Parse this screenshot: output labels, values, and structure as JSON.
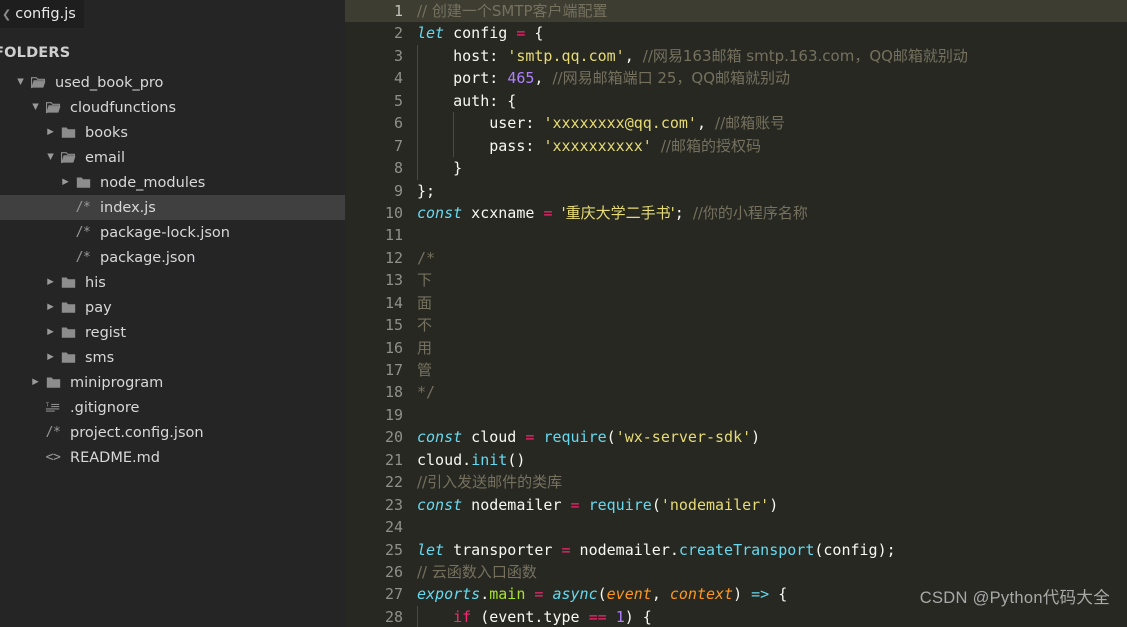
{
  "window": {
    "sidebar_bg": "#252526",
    "editor_bg": "#272822",
    "accent_selection": "#404040"
  },
  "tabs": {
    "open_file": "config.js",
    "overflow_icon": "chevron-left-icon"
  },
  "sidebar": {
    "section_label": "FOLDERS",
    "items": [
      {
        "label": "used_book_pro",
        "icon": "folder-open-icon",
        "twisty": "▼",
        "depth": 0,
        "selected": false
      },
      {
        "label": "cloudfunctions",
        "icon": "folder-open-icon",
        "twisty": "▼",
        "depth": 1,
        "selected": false
      },
      {
        "label": "books",
        "icon": "folder-closed-icon",
        "twisty": "▶",
        "depth": 2,
        "selected": false
      },
      {
        "label": "email",
        "icon": "folder-open-icon",
        "twisty": "▼",
        "depth": 2,
        "selected": false
      },
      {
        "label": "node_modules",
        "icon": "folder-closed-icon",
        "twisty": "▶",
        "depth": 3,
        "selected": false
      },
      {
        "label": "index.js",
        "icon": "js-file-icon",
        "twisty": "",
        "depth": 3,
        "selected": true
      },
      {
        "label": "package-lock.json",
        "icon": "js-file-icon",
        "twisty": "",
        "depth": 3,
        "selected": false
      },
      {
        "label": "package.json",
        "icon": "js-file-icon",
        "twisty": "",
        "depth": 3,
        "selected": false
      },
      {
        "label": "his",
        "icon": "folder-closed-icon",
        "twisty": "▶",
        "depth": 2,
        "selected": false
      },
      {
        "label": "pay",
        "icon": "folder-closed-icon",
        "twisty": "▶",
        "depth": 2,
        "selected": false
      },
      {
        "label": "regist",
        "icon": "folder-closed-icon",
        "twisty": "▶",
        "depth": 2,
        "selected": false
      },
      {
        "label": "sms",
        "icon": "folder-closed-icon",
        "twisty": "▶",
        "depth": 2,
        "selected": false
      },
      {
        "label": "miniprogram",
        "icon": "folder-closed-icon",
        "twisty": "▶",
        "depth": 1,
        "selected": false
      },
      {
        "label": ".gitignore",
        "icon": "git-file-icon",
        "twisty": "",
        "depth": 1,
        "selected": false
      },
      {
        "label": "project.config.json",
        "icon": "js-file-icon",
        "twisty": "",
        "depth": 1,
        "selected": false
      },
      {
        "label": "README.md",
        "icon": "markdown-file-icon",
        "twisty": "",
        "depth": 1,
        "selected": false
      }
    ]
  },
  "editor": {
    "active_line": 1,
    "first_line_number": 1,
    "lines": [
      {
        "n": 1,
        "indent": 0,
        "tokens": [
          {
            "t": "// 创建一个SMTP客户端配置",
            "c": "com cn"
          }
        ]
      },
      {
        "n": 2,
        "indent": 0,
        "tokens": [
          {
            "t": "let",
            "c": "kw"
          },
          {
            "t": " config ",
            "c": "plain"
          },
          {
            "t": "=",
            "c": "op"
          },
          {
            "t": " {",
            "c": "plain"
          }
        ]
      },
      {
        "n": 3,
        "indent": 1,
        "tokens": [
          {
            "t": "    host: ",
            "c": "plain"
          },
          {
            "t": "'smtp.qq.com'",
            "c": "str"
          },
          {
            "t": ", ",
            "c": "plain"
          },
          {
            "t": "//网易163邮箱 smtp.163.com，QQ邮箱就别动",
            "c": "com cn"
          }
        ]
      },
      {
        "n": 4,
        "indent": 1,
        "tokens": [
          {
            "t": "    port: ",
            "c": "plain"
          },
          {
            "t": "465",
            "c": "num"
          },
          {
            "t": ", ",
            "c": "plain"
          },
          {
            "t": "//网易邮箱端口 25，QQ邮箱就别动",
            "c": "com cn"
          }
        ]
      },
      {
        "n": 5,
        "indent": 1,
        "tokens": [
          {
            "t": "    auth: {",
            "c": "plain"
          }
        ]
      },
      {
        "n": 6,
        "indent": 2,
        "tokens": [
          {
            "t": "        user: ",
            "c": "plain"
          },
          {
            "t": "'xxxxxxxx@qq.com'",
            "c": "str"
          },
          {
            "t": ", ",
            "c": "plain"
          },
          {
            "t": "//邮箱账号",
            "c": "com cn"
          }
        ]
      },
      {
        "n": 7,
        "indent": 2,
        "tokens": [
          {
            "t": "        pass: ",
            "c": "plain"
          },
          {
            "t": "'xxxxxxxxxx'",
            "c": "str"
          },
          {
            "t": " ",
            "c": "plain"
          },
          {
            "t": "//邮箱的授权码",
            "c": "com cn"
          }
        ]
      },
      {
        "n": 8,
        "indent": 1,
        "tokens": [
          {
            "t": "    }",
            "c": "plain"
          }
        ]
      },
      {
        "n": 9,
        "indent": 0,
        "tokens": [
          {
            "t": "};",
            "c": "plain"
          }
        ]
      },
      {
        "n": 10,
        "indent": 0,
        "tokens": [
          {
            "t": "const",
            "c": "kw"
          },
          {
            "t": " xcxname ",
            "c": "plain"
          },
          {
            "t": "=",
            "c": "op"
          },
          {
            "t": " ",
            "c": "plain"
          },
          {
            "t": "'重庆大学二手书'",
            "c": "str cn"
          },
          {
            "t": "; ",
            "c": "plain"
          },
          {
            "t": "//你的小程序名称",
            "c": "com cn"
          }
        ]
      },
      {
        "n": 11,
        "indent": 0,
        "tokens": []
      },
      {
        "n": 12,
        "indent": 0,
        "tokens": [
          {
            "t": "/*",
            "c": "com"
          }
        ]
      },
      {
        "n": 13,
        "indent": 0,
        "tokens": [
          {
            "t": "下",
            "c": "com cn"
          }
        ]
      },
      {
        "n": 14,
        "indent": 0,
        "tokens": [
          {
            "t": "面",
            "c": "com cn"
          }
        ]
      },
      {
        "n": 15,
        "indent": 0,
        "tokens": [
          {
            "t": "不",
            "c": "com cn"
          }
        ]
      },
      {
        "n": 16,
        "indent": 0,
        "tokens": [
          {
            "t": "用",
            "c": "com cn"
          }
        ]
      },
      {
        "n": 17,
        "indent": 0,
        "tokens": [
          {
            "t": "管",
            "c": "com cn"
          }
        ]
      },
      {
        "n": 18,
        "indent": 0,
        "tokens": [
          {
            "t": "*/",
            "c": "com"
          }
        ]
      },
      {
        "n": 19,
        "indent": 0,
        "tokens": []
      },
      {
        "n": 20,
        "indent": 0,
        "tokens": [
          {
            "t": "const",
            "c": "kw"
          },
          {
            "t": " cloud ",
            "c": "plain"
          },
          {
            "t": "=",
            "c": "op"
          },
          {
            "t": " ",
            "c": "plain"
          },
          {
            "t": "require",
            "c": "mth"
          },
          {
            "t": "(",
            "c": "plain"
          },
          {
            "t": "'wx-server-sdk'",
            "c": "str"
          },
          {
            "t": ")",
            "c": "plain"
          }
        ]
      },
      {
        "n": 21,
        "indent": 0,
        "tokens": [
          {
            "t": "cloud.",
            "c": "plain"
          },
          {
            "t": "init",
            "c": "mth"
          },
          {
            "t": "()",
            "c": "plain"
          }
        ]
      },
      {
        "n": 22,
        "indent": 0,
        "tokens": [
          {
            "t": "//引入发送邮件的类库",
            "c": "com cn"
          }
        ]
      },
      {
        "n": 23,
        "indent": 0,
        "tokens": [
          {
            "t": "const",
            "c": "kw"
          },
          {
            "t": " nodemailer ",
            "c": "plain"
          },
          {
            "t": "=",
            "c": "op"
          },
          {
            "t": " ",
            "c": "plain"
          },
          {
            "t": "require",
            "c": "mth"
          },
          {
            "t": "(",
            "c": "plain"
          },
          {
            "t": "'nodemailer'",
            "c": "str"
          },
          {
            "t": ")",
            "c": "plain"
          }
        ]
      },
      {
        "n": 24,
        "indent": 0,
        "tokens": []
      },
      {
        "n": 25,
        "indent": 0,
        "tokens": [
          {
            "t": "let",
            "c": "kw"
          },
          {
            "t": " transporter ",
            "c": "plain"
          },
          {
            "t": "=",
            "c": "op"
          },
          {
            "t": " nodemailer.",
            "c": "plain"
          },
          {
            "t": "createTransport",
            "c": "mth"
          },
          {
            "t": "(config);",
            "c": "plain"
          }
        ]
      },
      {
        "n": 26,
        "indent": 0,
        "tokens": [
          {
            "t": "// 云函数入口函数",
            "c": "com cn"
          }
        ]
      },
      {
        "n": 27,
        "indent": 0,
        "tokens": [
          {
            "t": "exports",
            "c": "kw"
          },
          {
            "t": ".",
            "c": "plain"
          },
          {
            "t": "main",
            "c": "fn"
          },
          {
            "t": " ",
            "c": "plain"
          },
          {
            "t": "=",
            "c": "op"
          },
          {
            "t": " ",
            "c": "plain"
          },
          {
            "t": "async",
            "c": "kw"
          },
          {
            "t": "(",
            "c": "plain"
          },
          {
            "t": "event",
            "c": "param"
          },
          {
            "t": ", ",
            "c": "plain"
          },
          {
            "t": "context",
            "c": "param"
          },
          {
            "t": ") ",
            "c": "plain"
          },
          {
            "t": "=>",
            "c": "mth"
          },
          {
            "t": " {",
            "c": "plain"
          }
        ]
      },
      {
        "n": 28,
        "indent": 1,
        "tokens": [
          {
            "t": "    ",
            "c": "plain"
          },
          {
            "t": "if",
            "c": "op"
          },
          {
            "t": " (event.type ",
            "c": "plain"
          },
          {
            "t": "==",
            "c": "op"
          },
          {
            "t": " ",
            "c": "plain"
          },
          {
            "t": "1",
            "c": "num"
          },
          {
            "t": ") {",
            "c": "plain"
          }
        ]
      }
    ]
  },
  "watermark": {
    "text": "CSDN @Python代码大全"
  }
}
